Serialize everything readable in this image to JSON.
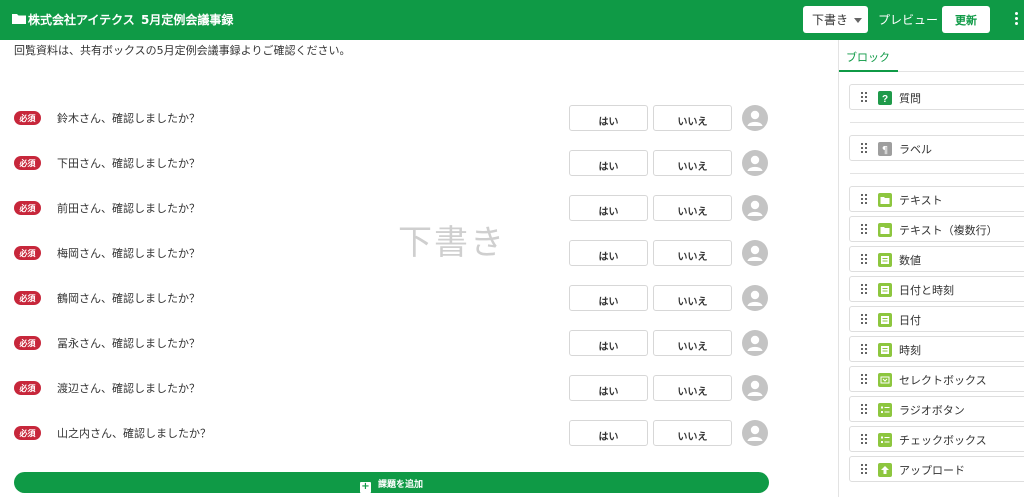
{
  "header": {
    "company": "株式会社アイテクス",
    "document_title": "5月定例会議事録",
    "status_select": "下書き",
    "preview_label": "プレビュー",
    "update_label": "更新",
    "brand_color": "#0f9a46"
  },
  "main": {
    "instruction": "回覧資料は、共有ボックスの5月定例会議事録よりご確認ください。",
    "watermark": "下書き",
    "required_badge": "必須",
    "yes_label": "はい",
    "no_label": "いいえ",
    "questions": [
      "鈴木さん、確認しましたか？",
      "下田さん、確認しましたか？",
      "前田さん、確認しましたか？",
      "梅岡さん、確認しましたか？",
      "鶴岡さん、確認しましたか？",
      "冨永さん、確認しましたか？",
      "渡辺さん、確認しましたか？",
      "山之内さん、確認しましたか？"
    ],
    "add_task_label": "課題を追加"
  },
  "sidebar": {
    "tab_label": "ブロック",
    "groups": [
      [
        {
          "label": "質問",
          "icon": "question-icon"
        }
      ],
      [
        {
          "label": "ラベル",
          "icon": "paragraph-icon"
        }
      ],
      [
        {
          "label": "テキスト",
          "icon": "text-field-icon"
        },
        {
          "label": "テキスト（複数行）",
          "icon": "textarea-icon"
        },
        {
          "label": "数値",
          "icon": "number-icon"
        },
        {
          "label": "日付と時刻",
          "icon": "datetime-icon"
        },
        {
          "label": "日付",
          "icon": "date-icon"
        },
        {
          "label": "時刻",
          "icon": "time-icon"
        },
        {
          "label": "セレクトボックス",
          "icon": "select-box-icon"
        },
        {
          "label": "ラジオボタン",
          "icon": "radio-list-icon"
        },
        {
          "label": "チェックボックス",
          "icon": "checkbox-list-icon"
        },
        {
          "label": "アップロード",
          "icon": "upload-icon"
        }
      ]
    ]
  }
}
